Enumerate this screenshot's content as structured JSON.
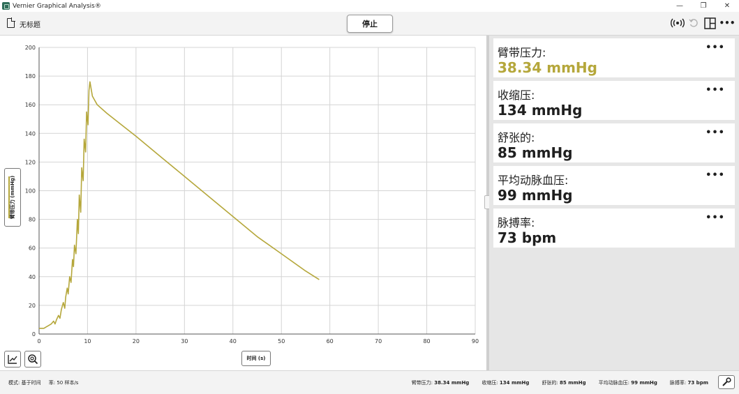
{
  "app": {
    "title": "Vernier Graphical Analysis®",
    "document_title": "无标题",
    "stop_label": "停止",
    "window_controls": [
      "—",
      "❐",
      "✕"
    ]
  },
  "toolbar_icons": [
    "wireless-sensor-icon",
    "undo-icon",
    "layout-icon",
    "more-menu-icon"
  ],
  "meters": [
    {
      "label": "臂带压力:",
      "value": "38.34 mmHg",
      "color": "#b5a73b"
    },
    {
      "label": "收缩压:",
      "value": "134 mmHg",
      "color": "#1f1f1f"
    },
    {
      "label": "舒张的:",
      "value": "85 mmHg",
      "color": "#1f1f1f"
    },
    {
      "label": "平均动脉血压:",
      "value": "99 mmHg",
      "color": "#1f1f1f"
    },
    {
      "label": "脉搏率:",
      "value": "73 bpm",
      "color": "#1f1f1f"
    }
  ],
  "meter_menu": "•••",
  "graph": {
    "y_axis_label": "臂带压力 (mmHg)",
    "x_axis_label": "时间 (s)"
  },
  "status": {
    "mode": "模式: 基于时间",
    "rate": "率: 50 样本/s",
    "readouts": [
      {
        "label": "臂带压力:",
        "value": "38.34 mmHg"
      },
      {
        "label": "收缩压:",
        "value": "134 mmHg"
      },
      {
        "label": "舒张的:",
        "value": "85 mmHg"
      },
      {
        "label": "平均动脉血压:",
        "value": "99 mmHg"
      },
      {
        "label": "脉搏率:",
        "value": "73 bpm"
      }
    ]
  },
  "chart_data": {
    "type": "line",
    "xlabel": "时间 (s)",
    "ylabel": "臂带压力 (mmHg)",
    "xlim": [
      0,
      90
    ],
    "ylim": [
      0,
      200
    ],
    "xticks": [
      0,
      10,
      20,
      30,
      40,
      50,
      60,
      70,
      80,
      90
    ],
    "yticks": [
      0,
      20,
      40,
      60,
      80,
      100,
      120,
      140,
      160,
      180,
      200
    ],
    "grid": true,
    "series": [
      {
        "color": "#b5a73b",
        "x": [
          0,
          1,
          1.5,
          2,
          2.5,
          3,
          3.3,
          3.6,
          4,
          4.3,
          4.6,
          5,
          5.3,
          5.5,
          5.8,
          6,
          6.3,
          6.6,
          6.9,
          7.1,
          7.3,
          7.6,
          7.9,
          8.1,
          8.3,
          8.6,
          8.8,
          9.1,
          9.3,
          9.6,
          9.8,
          10.1,
          10.3,
          10.5,
          11,
          12,
          14,
          17,
          20,
          25,
          30,
          35,
          40,
          45,
          50,
          55,
          57.8
        ],
        "y": [
          4,
          4,
          5,
          6,
          7,
          9,
          7,
          10,
          13,
          11,
          17,
          22,
          18,
          26,
          32,
          28,
          40,
          36,
          52,
          47,
          62,
          56,
          80,
          70,
          97,
          85,
          116,
          107,
          136,
          127,
          155,
          146,
          170,
          176,
          166,
          160,
          154,
          146,
          138,
          124,
          110,
          96,
          82,
          68,
          56,
          44,
          38
        ]
      }
    ]
  }
}
